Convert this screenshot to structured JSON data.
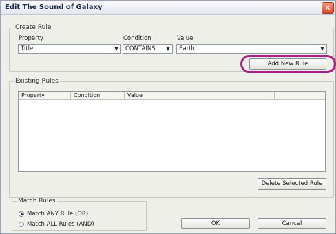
{
  "window": {
    "title": "Edit The Sound of Galaxy",
    "close_label": "✕"
  },
  "create_rule": {
    "group_title": "Create Rule",
    "property_label": "Property",
    "property_value": "Title",
    "condition_label": "Condition",
    "condition_value": "CONTAINS",
    "value_label": "Value",
    "value_value": "Earth",
    "add_button": "Add New Rule"
  },
  "existing_rules": {
    "group_title": "Existing Rules",
    "columns": [
      "Property",
      "Condition",
      "Value"
    ],
    "rows": [],
    "delete_button": "Delete Selected Rule"
  },
  "match_rules": {
    "group_title": "Match Rules",
    "options": [
      {
        "label": "Match ANY Rule (OR)",
        "selected": true
      },
      {
        "label": "Match ALL Rules (AND)",
        "selected": false
      }
    ]
  },
  "footer": {
    "ok_label": "OK",
    "cancel_label": "Cancel"
  },
  "colors": {
    "highlight": "#a81f86",
    "dialog_background": "#efefea"
  },
  "icons": {
    "dropdown_arrow": "chevron-down-icon",
    "close": "close-icon"
  }
}
